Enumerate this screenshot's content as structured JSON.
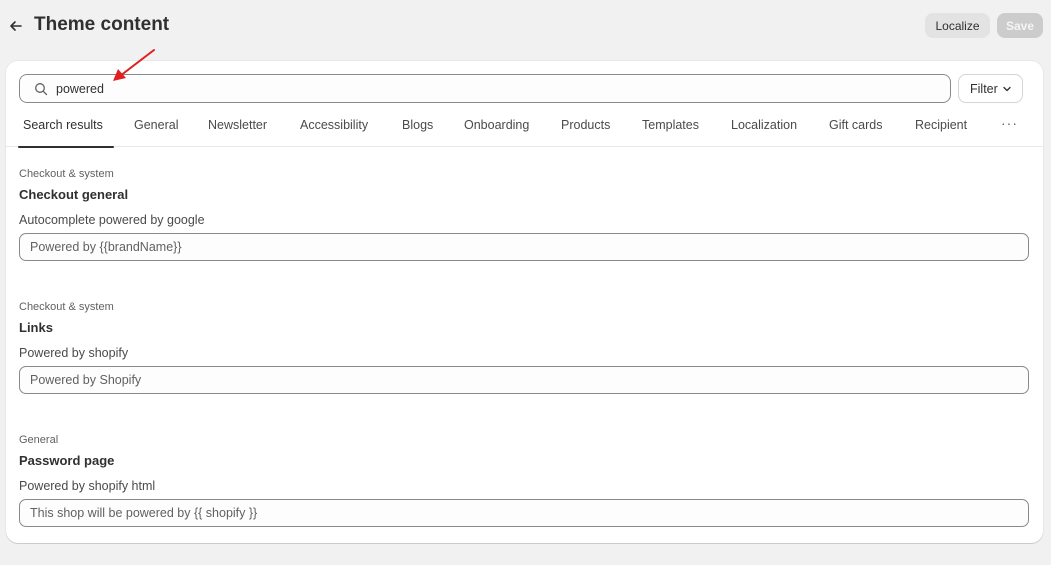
{
  "header": {
    "title": "Theme content",
    "back_icon": "arrow-left-icon",
    "localize_label": "Localize",
    "save_label": "Save"
  },
  "search": {
    "value": "powered",
    "icon": "search-icon",
    "filter_label": "Filter"
  },
  "tabs": [
    {
      "label": "Search results",
      "active": true
    },
    {
      "label": "General"
    },
    {
      "label": "Newsletter"
    },
    {
      "label": "Accessibility"
    },
    {
      "label": "Blogs"
    },
    {
      "label": "Onboarding"
    },
    {
      "label": "Products"
    },
    {
      "label": "Templates"
    },
    {
      "label": "Localization"
    },
    {
      "label": "Gift cards"
    },
    {
      "label": "Recipient"
    }
  ],
  "more_label": "···",
  "results": [
    {
      "category": "Checkout & system",
      "title": "Checkout general",
      "label": "Autocomplete powered by google",
      "value": "Powered by {{brandName}}"
    },
    {
      "category": "Checkout & system",
      "title": "Links",
      "label": "Powered by shopify",
      "value": "Powered by Shopify"
    },
    {
      "category": "General",
      "title": "Password page",
      "label": "Powered by shopify html",
      "value": "This shop will be powered by {{ shopify }}"
    }
  ],
  "colors": {
    "background": "#f1f1f1",
    "text": "#303030",
    "annotation_arrow": "#e02020"
  }
}
